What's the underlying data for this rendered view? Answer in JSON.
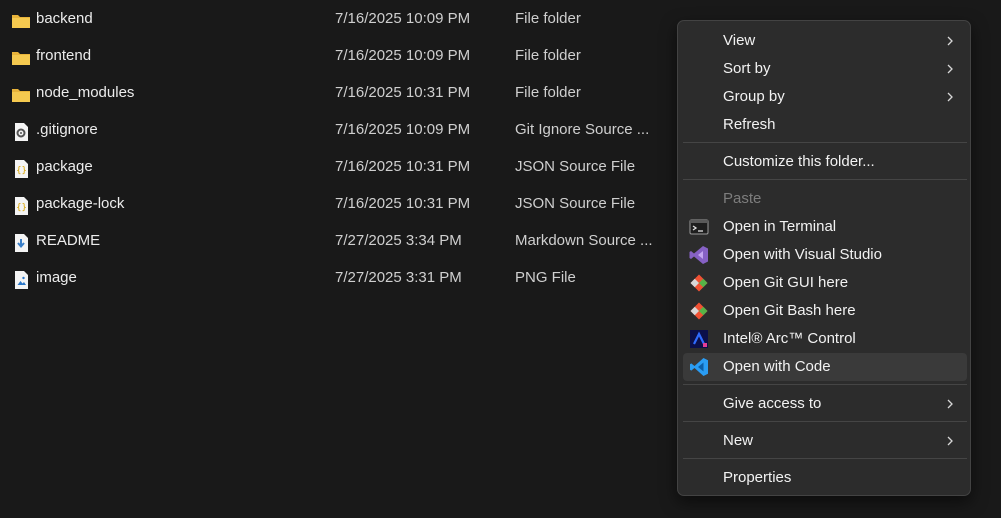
{
  "files": [
    {
      "name": "backend",
      "date": "7/16/2025 10:09 PM",
      "type": "File folder",
      "icon": "folder-icon"
    },
    {
      "name": "frontend",
      "date": "7/16/2025 10:09 PM",
      "type": "File folder",
      "icon": "folder-icon"
    },
    {
      "name": "node_modules",
      "date": "7/16/2025 10:31 PM",
      "type": "File folder",
      "icon": "folder-icon"
    },
    {
      "name": ".gitignore",
      "date": "7/16/2025 10:09 PM",
      "type": "Git Ignore Source ...",
      "icon": "settings-file-icon"
    },
    {
      "name": "package",
      "date": "7/16/2025 10:31 PM",
      "type": "JSON Source File",
      "icon": "json-file-icon"
    },
    {
      "name": "package-lock",
      "date": "7/16/2025 10:31 PM",
      "type": "JSON Source File",
      "icon": "json-file-icon"
    },
    {
      "name": "README",
      "date": "7/27/2025 3:34 PM",
      "type": "Markdown Source ...",
      "icon": "markdown-file-icon"
    },
    {
      "name": "image",
      "date": "7/27/2025 3:31 PM",
      "type": "PNG File",
      "icon": "image-file-icon"
    }
  ],
  "context_menu": {
    "view": "View",
    "sort_by": "Sort by",
    "group_by": "Group by",
    "refresh": "Refresh",
    "customize": "Customize this folder...",
    "paste": "Paste",
    "open_terminal": "Open in Terminal",
    "open_vs": "Open with Visual Studio",
    "git_gui": "Open Git GUI here",
    "git_bash": "Open Git Bash here",
    "intel_arc": "Intel® Arc™ Control",
    "open_code": "Open with Code",
    "give_access": "Give access to",
    "new": "New",
    "properties": "Properties"
  },
  "colors": {
    "background": "#191919",
    "menu_background": "#2c2c2c",
    "folder": "#f2c14e",
    "vscode_blue": "#2a9df4",
    "visual_studio_purple": "#8661c5",
    "git_orange": "#f05133"
  }
}
